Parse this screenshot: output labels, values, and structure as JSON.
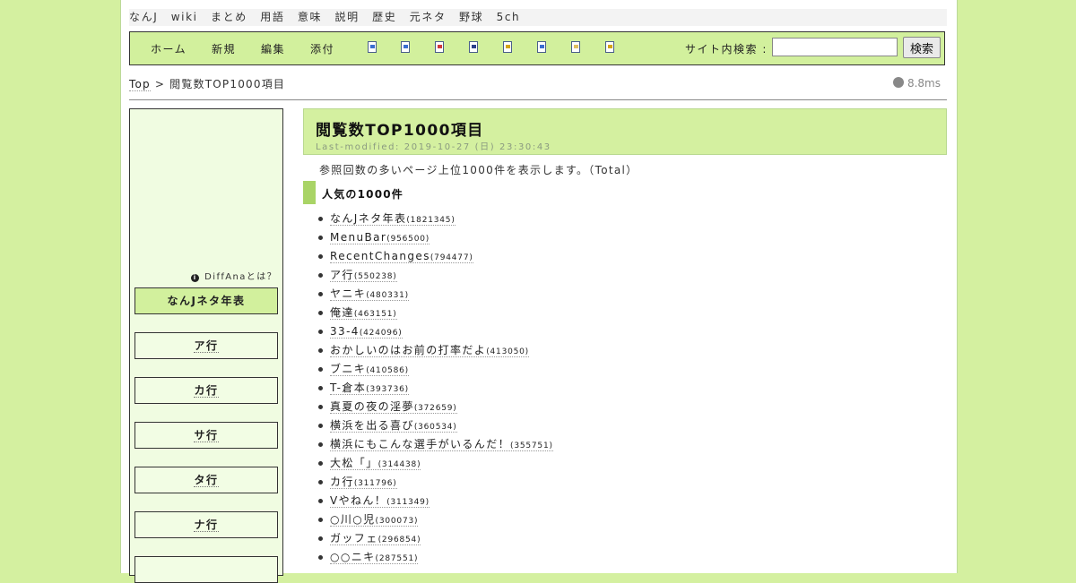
{
  "site_nav": [
    "なんJ",
    "wiki",
    "まとめ",
    "用語",
    "意味",
    "説明",
    "歴史",
    "元ネタ",
    "野球",
    "5ch"
  ],
  "toolbar": {
    "links": [
      "ホーム",
      "新規",
      "編集",
      "添付"
    ],
    "icons": [
      {
        "name": "page-icon",
        "color": "#3a6ed0"
      },
      {
        "name": "refresh-icon",
        "color": "#3a6ed0"
      },
      {
        "name": "diff-icon",
        "color": "#d03a3a"
      },
      {
        "name": "save-icon",
        "color": "#2a3f8a"
      },
      {
        "name": "lock-icon",
        "color": "#d4a417"
      },
      {
        "name": "copy-icon",
        "color": "#3a6ed0"
      },
      {
        "name": "list-icon",
        "color": "#e0c060"
      },
      {
        "name": "help-icon",
        "color": "#d4a417"
      }
    ],
    "search_label": "サイト内検索 :",
    "search_value": "",
    "search_button": "検索"
  },
  "breadcrumb": {
    "top": "Top",
    "sep": ">",
    "current": "閲覧数TOP1000項目"
  },
  "timing": "8.8ms",
  "sidebar": {
    "diffana_label": "DiffAnaとは？",
    "buttons": [
      "なんJネタ年表",
      "ア行",
      "カ行",
      "サ行",
      "タ行",
      "ナ行"
    ]
  },
  "main": {
    "title": "閲覧数TOP1000項目",
    "last_modified": "Last-modified: 2019-10-27 (日) 23:30:43",
    "description": "参照回数の多いページ上位1000件を表示します。（Total）",
    "section_title": "人気の1000件",
    "items": [
      {
        "name": "なんJネタ年表",
        "count": "(1821345)"
      },
      {
        "name": "MenuBar",
        "count": "(956500)"
      },
      {
        "name": "RecentChanges",
        "count": "(794477)"
      },
      {
        "name": "ア行",
        "count": "(550238)"
      },
      {
        "name": "ヤニキ",
        "count": "(480331)"
      },
      {
        "name": "俺達",
        "count": "(463151)"
      },
      {
        "name": "33-4",
        "count": "(424096)"
      },
      {
        "name": "おかしいのはお前の打率だよ",
        "count": "(413050)"
      },
      {
        "name": "ブニキ",
        "count": "(410586)"
      },
      {
        "name": "T-倉本",
        "count": "(393736)"
      },
      {
        "name": "真夏の夜の淫夢",
        "count": "(372659)"
      },
      {
        "name": "横浜を出る喜び",
        "count": "(360534)"
      },
      {
        "name": "横浜にもこんな選手がいるんだ！",
        "count": "(355751)"
      },
      {
        "name": "大松「」",
        "count": "(314438)"
      },
      {
        "name": "カ行",
        "count": "(311796)"
      },
      {
        "name": "Vやねん！",
        "count": "(311349)"
      },
      {
        "name": "○川○児",
        "count": "(300073)"
      },
      {
        "name": "ガッフェ",
        "count": "(296854)"
      },
      {
        "name": "○○ニキ",
        "count": "(287551)"
      }
    ]
  }
}
